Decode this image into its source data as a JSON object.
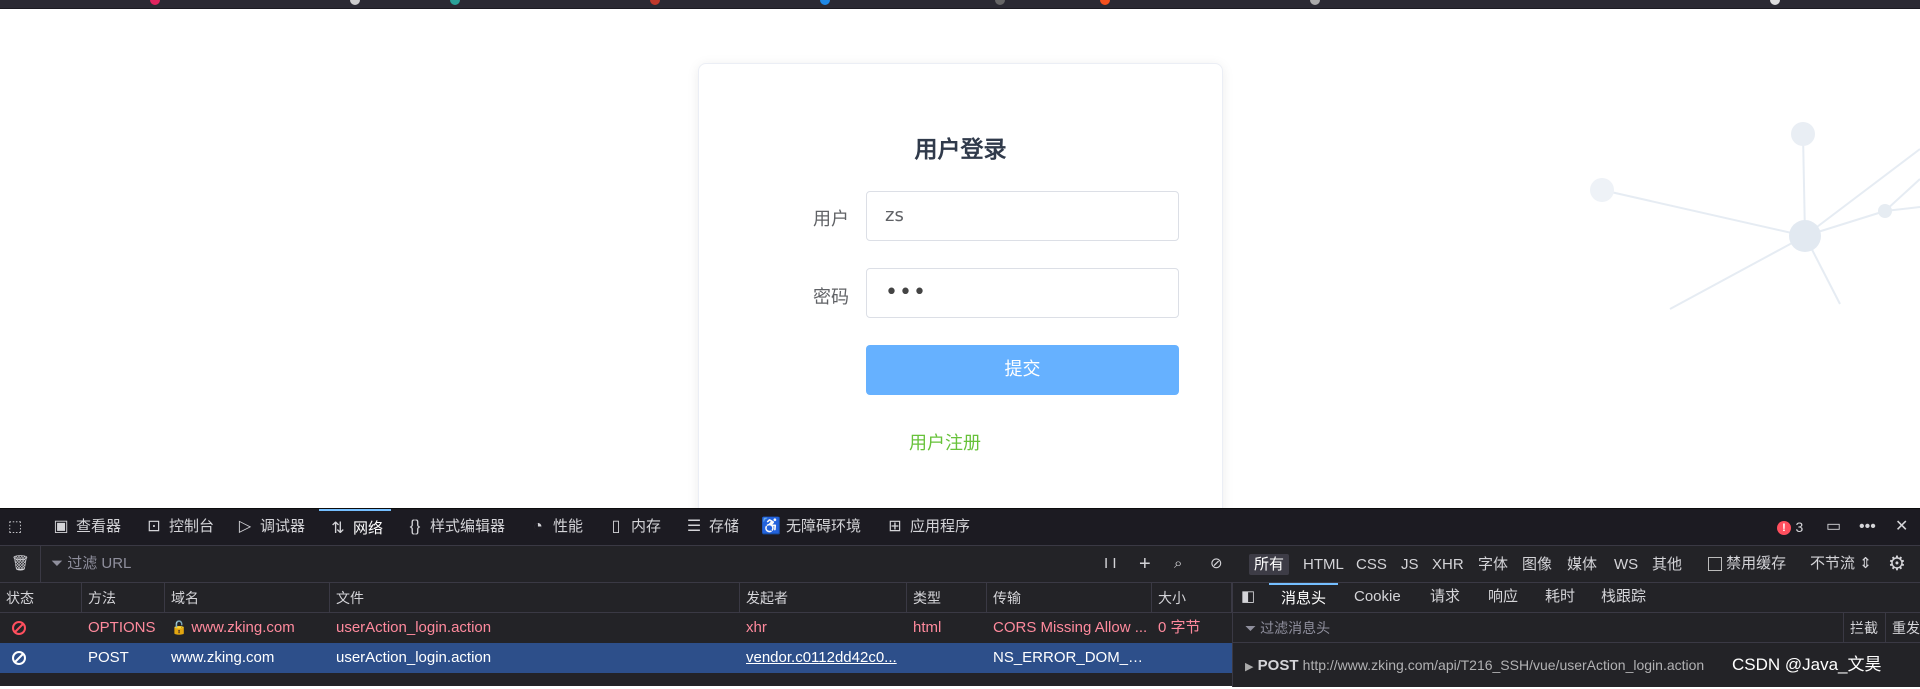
{
  "login": {
    "title": "用户登录",
    "username_label": "用户",
    "username_value": "zs",
    "password_label": "密码",
    "password_value": "•••",
    "submit_label": "提交",
    "register_label": "用户注册"
  },
  "devtools": {
    "tabs": [
      {
        "label": "查看器"
      },
      {
        "label": "控制台"
      },
      {
        "label": "调试器"
      },
      {
        "label": "网络"
      },
      {
        "label": "样式编辑器"
      },
      {
        "label": "性能"
      },
      {
        "label": "内存"
      },
      {
        "label": "存储"
      },
      {
        "label": "无障碍环境"
      },
      {
        "label": "应用程序"
      }
    ],
    "error_count": "3",
    "toolbar": {
      "filter_placeholder": "过滤 URL",
      "pause_label": "I I",
      "types": [
        "所有",
        "HTML",
        "CSS",
        "JS",
        "XHR",
        "字体",
        "图像",
        "媒体",
        "WS",
        "其他"
      ],
      "disable_cache_label": "禁用缓存",
      "throttle_label": "不节流"
    },
    "columns": [
      "状态",
      "方法",
      "域名",
      "文件",
      "发起者",
      "类型",
      "传输",
      "大小"
    ],
    "rows": [
      {
        "method": "OPTIONS",
        "domain": "www.zking.com",
        "file": "userAction_login.action",
        "initiator": "xhr",
        "type": "html",
        "transfer": "CORS Missing Allow ...",
        "size": "0 字节"
      },
      {
        "method": "POST",
        "domain": "www.zking.com",
        "file": "userAction_login.action",
        "initiator": "vendor.c0112dd42c0...",
        "type": "",
        "transfer": "NS_ERROR_DOM_BA...",
        "size": ""
      }
    ],
    "side_tabs": [
      "消息头",
      "Cookie",
      "请求",
      "响应",
      "耗时",
      "栈跟踪"
    ],
    "side_filter_placeholder": "过滤消息头",
    "block_label": "拦截",
    "resend_label": "重发",
    "request_method": "POST",
    "request_url": "http://www.zking.com/api/T216_SSH/vue/userAction_login.action",
    "watermark": "CSDN @Java_文昊"
  },
  "colors": {
    "accent_blue": "#66b1ff",
    "link_green": "#67c23a",
    "devtools_bg": "#232327",
    "selected_row": "#2d4f8a",
    "error_red": "#ff4f5e"
  }
}
